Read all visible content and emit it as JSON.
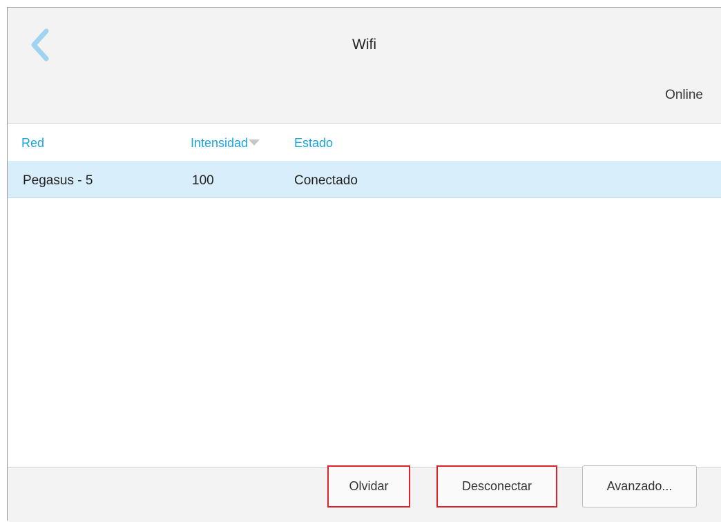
{
  "header": {
    "title": "Wifi",
    "status": "Online",
    "back_icon": "chevron-left-icon",
    "accent": "#1aa3dc"
  },
  "table": {
    "columns": [
      "Red",
      "Intensidad",
      "Estado"
    ],
    "sort_icon": "sort-down-icon",
    "rows": [
      {
        "red": "Pegasus - 5",
        "intensidad": "100",
        "estado": "Conectado"
      }
    ],
    "selected_row_color": "#d9eefb"
  },
  "footer": {
    "buttons": [
      "Olvidar",
      "Desconectar",
      "Avanzado..."
    ],
    "highlight_color": "#e0212b"
  }
}
